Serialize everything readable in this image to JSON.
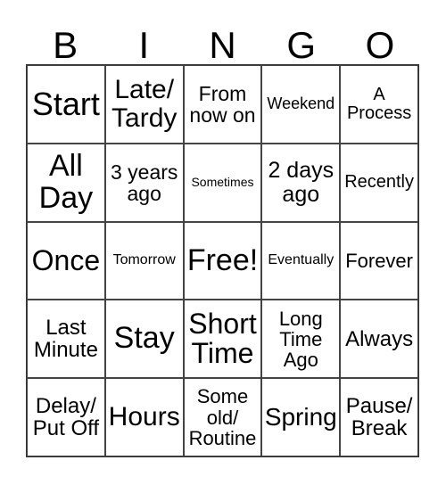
{
  "header": [
    "B",
    "I",
    "N",
    "G",
    "O"
  ],
  "cells": [
    [
      "Start",
      "Late/ Tardy",
      "From now on",
      "Weekend",
      "A Process"
    ],
    [
      "All Day",
      "3 years ago",
      "Sometimes",
      "2 days ago",
      "Recently"
    ],
    [
      "Once",
      "Tomorrow",
      "Free!",
      "Eventually",
      "Forever"
    ],
    [
      "Last Minute",
      "Stay",
      "Short Time",
      "Long Time Ago",
      "Always"
    ],
    [
      "Delay/ Put Off",
      "Hours",
      "Some old/ Routine",
      "Spring",
      "Pause/ Break"
    ]
  ]
}
